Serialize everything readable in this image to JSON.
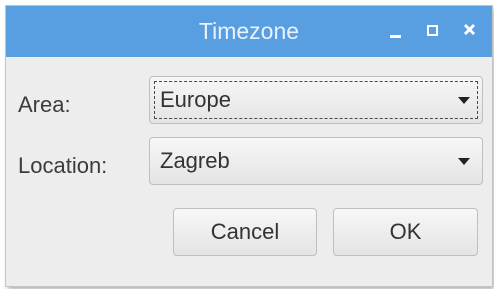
{
  "window": {
    "title": "Timezone",
    "colors": {
      "titlebar": "#579fe0",
      "title_text": "#eaf2fb",
      "background": "#ededed"
    },
    "controls": {
      "minimize_icon": "minimize-icon",
      "maximize_icon": "maximize-icon",
      "close_icon": "close-icon"
    }
  },
  "form": {
    "area": {
      "label": "Area:",
      "value": "Europe"
    },
    "location": {
      "label": "Location:",
      "value": "Zagreb"
    }
  },
  "buttons": {
    "cancel": "Cancel",
    "ok": "OK"
  }
}
